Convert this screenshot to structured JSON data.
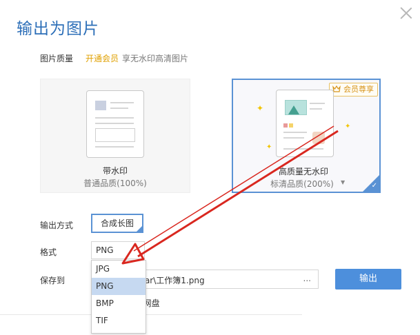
{
  "dialog": {
    "title": "输出为图片"
  },
  "quality": {
    "label": "图片质量",
    "vip_link": "开通会员",
    "vip_tip": "享无水印高清图片",
    "options": [
      {
        "name": "带水印",
        "desc": "普通品质(100%)"
      },
      {
        "name": "高质量无水印",
        "desc": "标清品质(200%)",
        "badge": "会员尊享",
        "selected": true
      }
    ]
  },
  "output_mode": {
    "label": "输出方式",
    "value": "合成长图"
  },
  "format": {
    "label": "格式",
    "value": "PNG",
    "options": [
      "JPG",
      "PNG",
      "BMP",
      "TIF"
    ],
    "highlighted": "PNG"
  },
  "save": {
    "label": "保存到",
    "path": "star\\工作簿1.png",
    "browse": "...",
    "cloud": "S网盘"
  },
  "export_button": "输出",
  "colors": {
    "accent": "#4d8fdc",
    "vip": "#e0a000",
    "annotation_arrow": "#d9271f"
  }
}
